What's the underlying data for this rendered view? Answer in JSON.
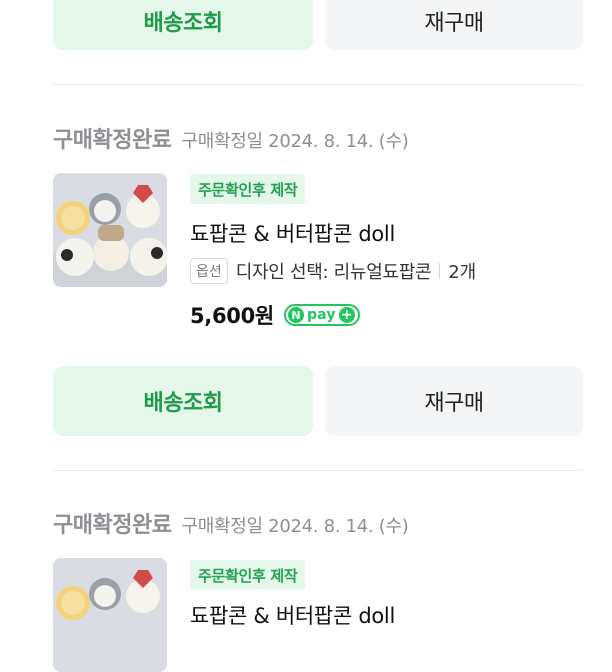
{
  "top_actions": {
    "track_label": "배송조회",
    "rebuy_label": "재구매"
  },
  "orders": [
    {
      "status": "구매확정완료",
      "confirm_date": "구매확정일 2024. 8. 14. (수)",
      "tag": "주문확인후 제작",
      "title": "됴팝콘 & 버터팝콘 doll",
      "option_badge": "옵션",
      "option_text": "디자인 선택: 리뉴얼됴팝콘",
      "quantity": "2개",
      "price": "5,600원",
      "npay_n": "N",
      "npay_label": "pay",
      "npay_plus": "+",
      "track_label": "배송조회",
      "rebuy_label": "재구매"
    },
    {
      "status": "구매확정완료",
      "confirm_date": "구매확정일 2024. 8. 14. (수)",
      "tag": "주문확인후 제작",
      "title": "됴팝콘 & 버터팝콘 doll"
    }
  ],
  "colors": {
    "primary_green": "#1f9a48",
    "green_bg": "#e4f7ea",
    "npay_green": "#22c55e",
    "gray_bg": "#f3f5f6",
    "muted_text": "#8d8f93"
  }
}
